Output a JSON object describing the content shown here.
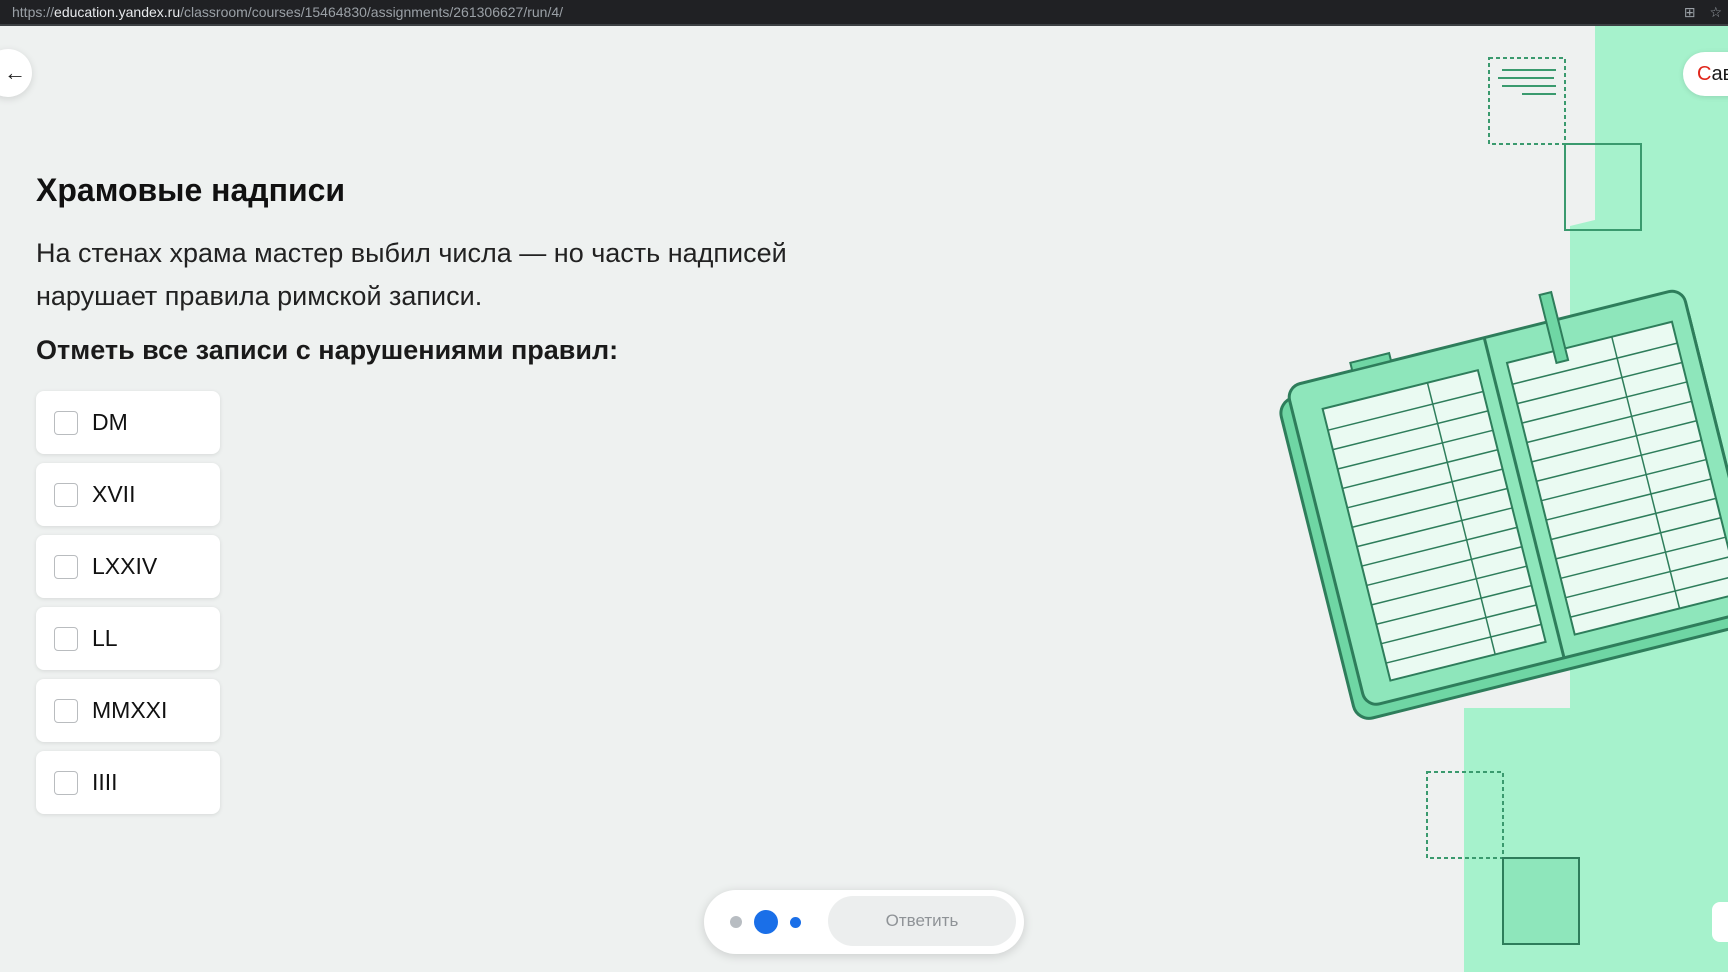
{
  "browser": {
    "url_prefix": "https://",
    "url_host": "education.yandex.ru",
    "url_path": "/classroom/courses/15464830/assignments/261306627/run/4/"
  },
  "nav": {
    "back_icon": "←"
  },
  "header": {
    "save_label_first": "С",
    "save_label_rest": "ав"
  },
  "task": {
    "title": "Храмовые надписи",
    "description": "На стенах храма мастер выбил числа — но часть надписей нарушает правила римской записи.",
    "prompt": "Отметь все записи с нарушениями правил:",
    "options": [
      {
        "label": "DM",
        "checked": false
      },
      {
        "label": "XVII",
        "checked": false
      },
      {
        "label": "LXXIV",
        "checked": false
      },
      {
        "label": "LL",
        "checked": false
      },
      {
        "label": "MMXXI",
        "checked": false
      },
      {
        "label": "IIII",
        "checked": false
      }
    ]
  },
  "footer": {
    "answer_label": "Ответить"
  },
  "colors": {
    "accent": "#1a6fe8",
    "illustration_green": "#a6f2cc",
    "illustration_dark": "#3a9a6e"
  }
}
